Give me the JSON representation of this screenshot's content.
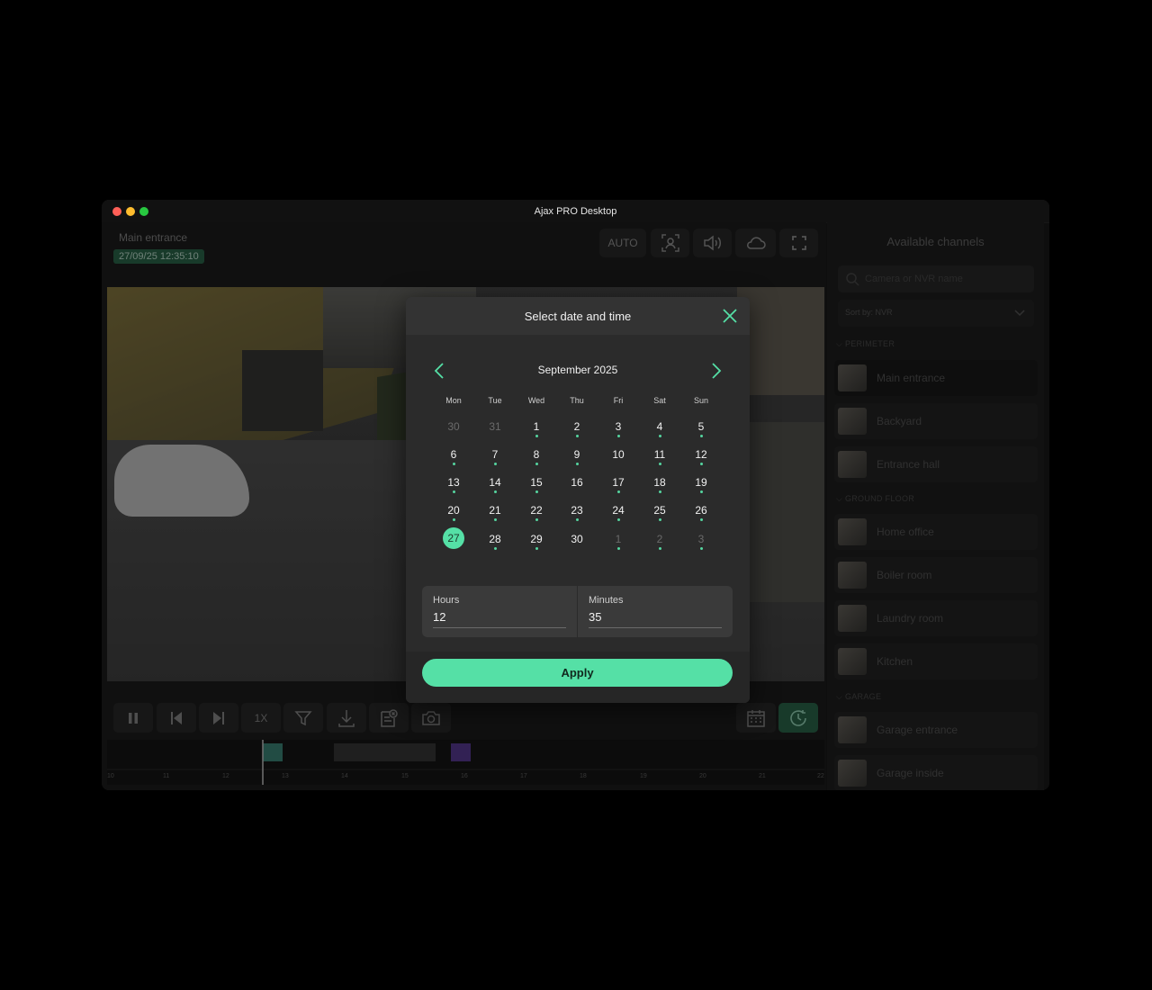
{
  "window": {
    "title": "Ajax PRO Desktop"
  },
  "camera": {
    "name": "Main entrance",
    "timestamp": "27/09/25 12:35:10"
  },
  "toolbar": {
    "auto_label": "AUTO",
    "speed_label": "1X"
  },
  "timeline": {
    "ticks": [
      "10",
      "11",
      "12",
      "13",
      "14",
      "15",
      "16",
      "17",
      "18",
      "19",
      "20",
      "21",
      "22"
    ]
  },
  "sidebar": {
    "title": "Available channels",
    "search_placeholder": "Camera or NVR name",
    "sort_label": "Sort by: NVR",
    "groups": [
      {
        "name": "PERIMETER",
        "channels": [
          "Main entrance",
          "Backyard",
          "Entrance hall"
        ]
      },
      {
        "name": "GROUND FLOOR",
        "channels": [
          "Home office",
          "Boiler room",
          "Laundry room",
          "Kitchen"
        ]
      },
      {
        "name": "GARAGE",
        "channels": [
          "Garage entrance",
          "Garage inside"
        ]
      }
    ]
  },
  "modal": {
    "title": "Select date and time",
    "month_label": "September 2025",
    "weekdays": [
      "Mon",
      "Tue",
      "Wed",
      "Thu",
      "Fri",
      "Sat",
      "Sun"
    ],
    "weeks": [
      [
        {
          "d": "30",
          "m": true,
          "dot": false
        },
        {
          "d": "31",
          "m": true,
          "dot": false
        },
        {
          "d": "1",
          "m": false,
          "dot": true
        },
        {
          "d": "2",
          "m": false,
          "dot": true
        },
        {
          "d": "3",
          "m": false,
          "dot": true
        },
        {
          "d": "4",
          "m": false,
          "dot": true
        },
        {
          "d": "5",
          "m": false,
          "dot": true
        }
      ],
      [
        {
          "d": "6",
          "m": false,
          "dot": true
        },
        {
          "d": "7",
          "m": false,
          "dot": true
        },
        {
          "d": "8",
          "m": false,
          "dot": true
        },
        {
          "d": "9",
          "m": false,
          "dot": true
        },
        {
          "d": "10",
          "m": false,
          "dot": false
        },
        {
          "d": "11",
          "m": false,
          "dot": true
        },
        {
          "d": "12",
          "m": false,
          "dot": true
        }
      ],
      [
        {
          "d": "13",
          "m": false,
          "dot": true
        },
        {
          "d": "14",
          "m": false,
          "dot": true
        },
        {
          "d": "15",
          "m": false,
          "dot": true
        },
        {
          "d": "16",
          "m": false,
          "dot": false
        },
        {
          "d": "17",
          "m": false,
          "dot": true
        },
        {
          "d": "18",
          "m": false,
          "dot": true
        },
        {
          "d": "19",
          "m": false,
          "dot": true
        }
      ],
      [
        {
          "d": "20",
          "m": false,
          "dot": true
        },
        {
          "d": "21",
          "m": false,
          "dot": true
        },
        {
          "d": "22",
          "m": false,
          "dot": true
        },
        {
          "d": "23",
          "m": false,
          "dot": true
        },
        {
          "d": "24",
          "m": false,
          "dot": true
        },
        {
          "d": "25",
          "m": false,
          "dot": true
        },
        {
          "d": "26",
          "m": false,
          "dot": true
        }
      ],
      [
        {
          "d": "27",
          "m": false,
          "dot": false,
          "sel": true
        },
        {
          "d": "28",
          "m": false,
          "dot": true
        },
        {
          "d": "29",
          "m": false,
          "dot": true
        },
        {
          "d": "30",
          "m": false,
          "dot": false
        },
        {
          "d": "1",
          "m": true,
          "dot": true
        },
        {
          "d": "2",
          "m": true,
          "dot": true
        },
        {
          "d": "3",
          "m": true,
          "dot": true
        }
      ]
    ],
    "hours_label": "Hours",
    "hours_value": "12",
    "minutes_label": "Minutes",
    "minutes_value": "35",
    "apply_label": "Apply"
  },
  "colors": {
    "accent": "#55e0a6",
    "modal_bg": "#2b2b2b",
    "badge": "#2d6b4e"
  }
}
